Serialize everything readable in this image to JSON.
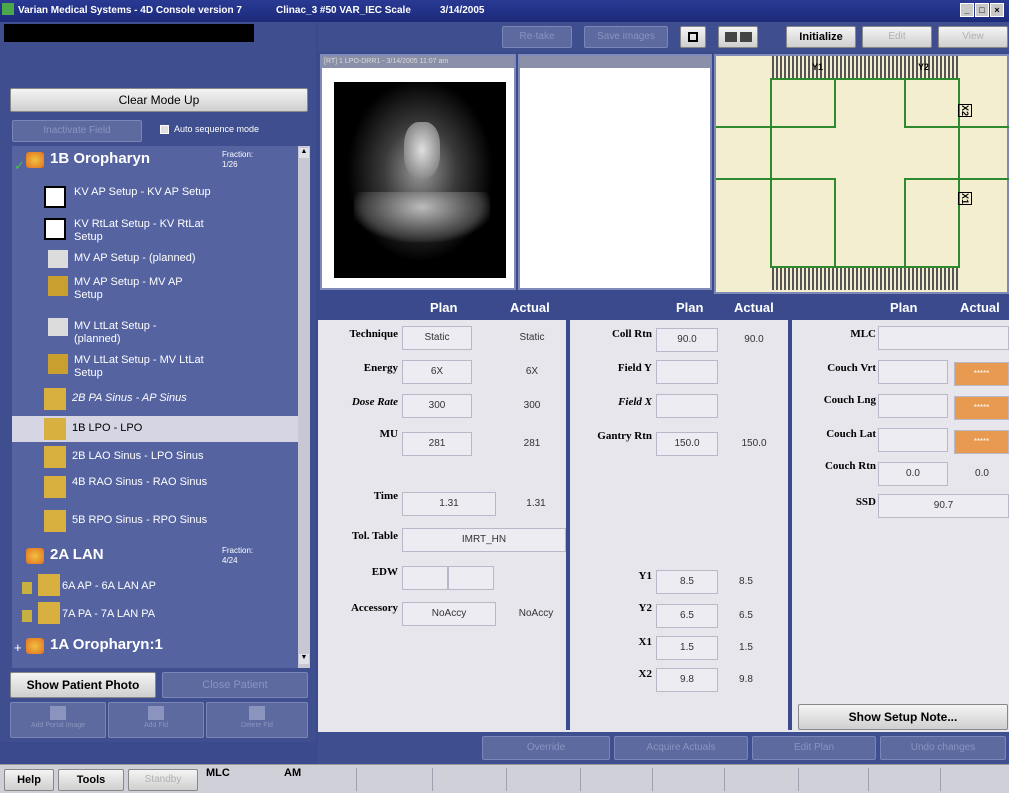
{
  "titlebar": {
    "app": "Varian Medical Systems - 4D Console version 7",
    "machine": "Clinac_3 #50 VAR_IEC Scale",
    "date": "3/14/2005",
    "minimize": "_",
    "maximize": "□",
    "close": "×"
  },
  "left": {
    "clear_mode": "Clear Mode Up",
    "inactivate": "Inactivate Field",
    "auto_sequence": "Auto sequence mode",
    "plans": [
      {
        "name": "1B Oropharyn",
        "fraction_label": "Fraction:",
        "fraction": "1/26"
      },
      {
        "name": "2A LAN",
        "fraction_label": "Fraction:",
        "fraction": "4/24"
      },
      {
        "name": "1A Oropharyn:1"
      }
    ],
    "fields": [
      "KV AP Setup - KV AP Setup",
      "KV RtLat Setup - KV RtLat Setup",
      "MV AP Setup - (planned)",
      "MV AP Setup - MV AP Setup",
      "MV LtLat Setup - (planned)",
      "MV LtLat Setup - MV LtLat Setup",
      "2B PA Sinus - AP Sinus",
      "1B LPO - LPO",
      "2B LAO Sinus - LPO Sinus",
      "4B RAO Sinus - RAO Sinus",
      "5B RPO Sinus - RPO Sinus",
      "6A AP - 6A LAN AP",
      "7A PA - 7A LAN PA"
    ],
    "show_photo": "Show Patient Photo",
    "close_patient": "Close Patient",
    "tool_buttons": [
      "Add Portal Image",
      "Add Fld",
      "Delete Fld"
    ]
  },
  "top": {
    "retake": "Re-take",
    "save_images": "Save images",
    "initialize": "Initialize",
    "edit": "Edit",
    "view": "View",
    "image_caption": "[RT] 1 LPO-DRR1 - 3/14/2005 11:07 am",
    "bev_labels": {
      "y1": "Y1",
      "y2": "Y2",
      "x2": "X2",
      "x1": "X1"
    }
  },
  "table": {
    "plan_header": "Plan",
    "actual_header": "Actual",
    "col1": [
      {
        "label": "Technique",
        "plan": "Static",
        "actual": "Static"
      },
      {
        "label": "Energy",
        "plan": "6X",
        "actual": "6X"
      },
      {
        "label": "Dose Rate",
        "plan": "300",
        "actual": "300"
      },
      {
        "label": "MU",
        "plan": "281",
        "actual": "281"
      },
      {
        "label": "Time",
        "plan": "1.31",
        "actual": "1.31"
      },
      {
        "label": "Tol. Table",
        "plan": "IMRT_HN",
        "actual": ""
      },
      {
        "label": "EDW",
        "plan": "",
        "actual": ""
      },
      {
        "label": "Accessory",
        "plan": "NoAccy",
        "actual": "NoAccy"
      }
    ],
    "col2": [
      {
        "label": "Coll Rtn",
        "plan": "90.0",
        "actual": "90.0"
      },
      {
        "label": "Field Y",
        "plan": "",
        "actual": ""
      },
      {
        "label": "Field X",
        "plan": "",
        "actual": ""
      },
      {
        "label": "Gantry Rtn",
        "plan": "150.0",
        "actual": "150.0"
      },
      {
        "label": "Y1",
        "plan": "8.5",
        "actual": "8.5"
      },
      {
        "label": "Y2",
        "plan": "6.5",
        "actual": "6.5"
      },
      {
        "label": "X1",
        "plan": "1.5",
        "actual": "1.5"
      },
      {
        "label": "X2",
        "plan": "9.8",
        "actual": "9.8"
      }
    ],
    "col3": [
      {
        "label": "MLC",
        "plan": "",
        "actual": ""
      },
      {
        "label": "Couch Vrt",
        "plan": "",
        "actual": "*****"
      },
      {
        "label": "Couch Lng",
        "plan": "",
        "actual": "*****"
      },
      {
        "label": "Couch Lat",
        "plan": "",
        "actual": "*****"
      },
      {
        "label": "Couch Rtn",
        "plan": "0.0",
        "actual": "0.0"
      },
      {
        "label": "SSD",
        "plan": "90.7",
        "actual": ""
      }
    ],
    "show_setup_note": "Show Setup Note..."
  },
  "bottom": {
    "override": "Override",
    "acquire_actuals": "Acquire Actuals",
    "edit_plan": "Edit Plan",
    "undo": "Undo changes"
  },
  "status": {
    "help": "Help",
    "tools": "Tools",
    "standby": "Standby",
    "mlc": "MLC",
    "am": "AM"
  },
  "colors": {
    "accent": "#3a4a8c",
    "orange": "#e89a50",
    "bev_green": "#2e8a2e",
    "bev_bg": "#f4eed0"
  }
}
